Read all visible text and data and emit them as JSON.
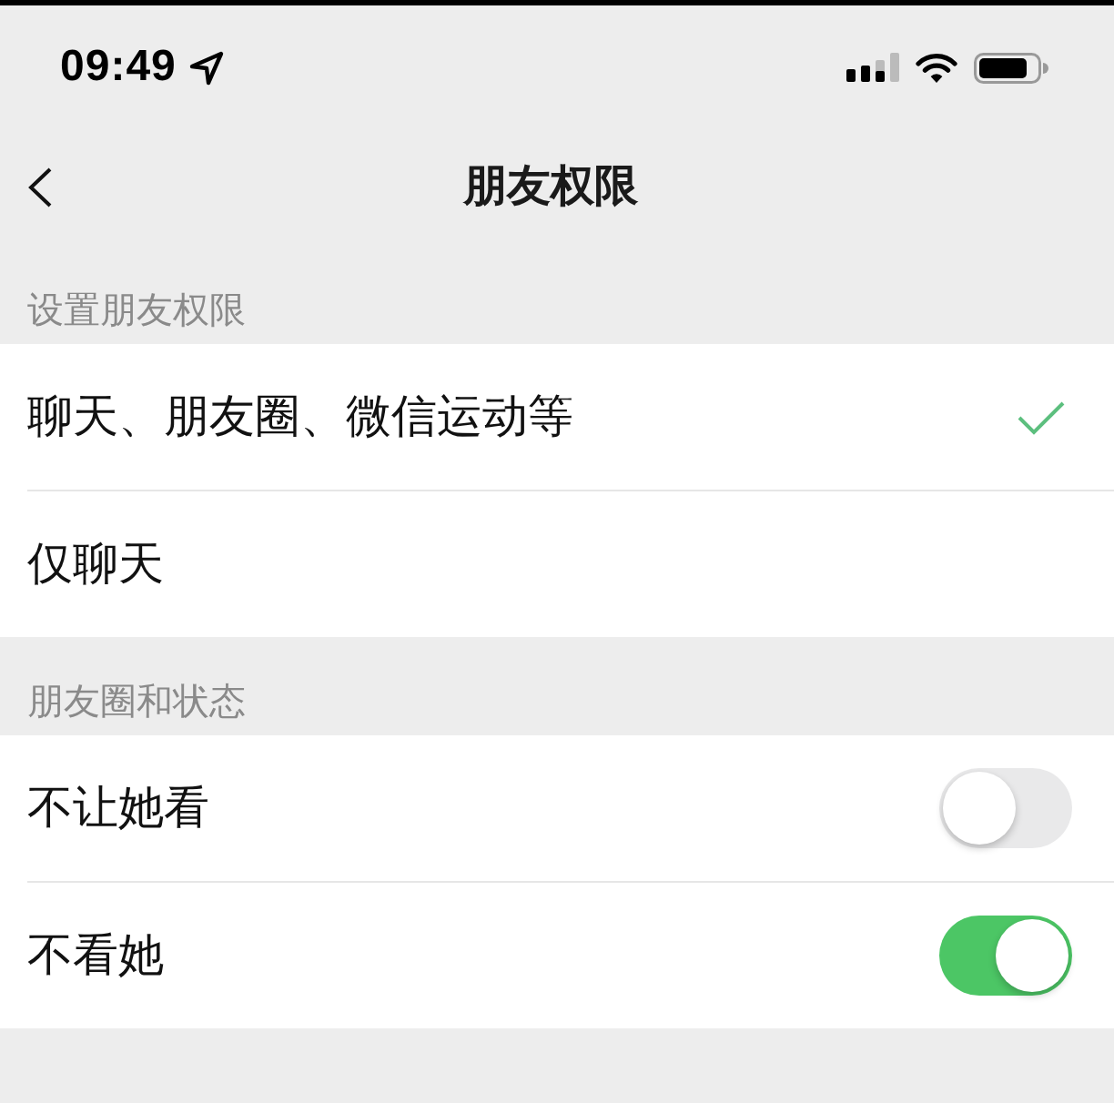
{
  "status_bar": {
    "time": "09:49"
  },
  "nav": {
    "title": "朋友权限"
  },
  "sections": [
    {
      "header": "设置朋友权限",
      "items": [
        {
          "kind": "choice",
          "label": "聊天、朋友圈、微信运动等",
          "selected": true
        },
        {
          "kind": "choice",
          "label": "仅聊天",
          "selected": false
        }
      ]
    },
    {
      "header": "朋友圈和状态",
      "items": [
        {
          "kind": "switch",
          "label": "不让她看",
          "on": false
        },
        {
          "kind": "switch",
          "label": "不看她",
          "on": true
        }
      ]
    }
  ]
}
